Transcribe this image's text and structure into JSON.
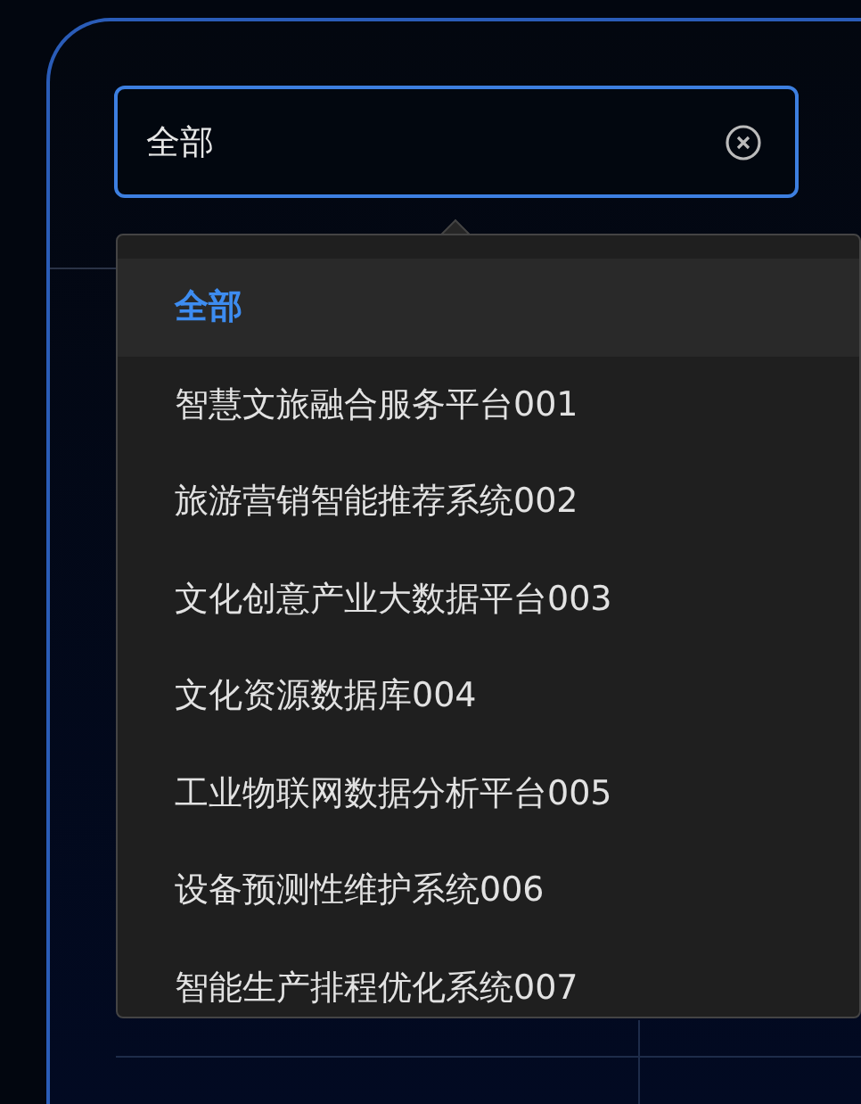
{
  "select": {
    "value": "全部"
  },
  "options": [
    {
      "label": "全部",
      "selected": true
    },
    {
      "label": "智慧文旅融合服务平台001",
      "selected": false
    },
    {
      "label": "旅游营销智能推荐系统002",
      "selected": false
    },
    {
      "label": "文化创意产业大数据平台003",
      "selected": false
    },
    {
      "label": "文化资源数据库004",
      "selected": false
    },
    {
      "label": "工业物联网数据分析平台005",
      "selected": false
    },
    {
      "label": "设备预测性维护系统006",
      "selected": false
    },
    {
      "label": "智能生产排程优化系统007",
      "selected": false
    }
  ]
}
